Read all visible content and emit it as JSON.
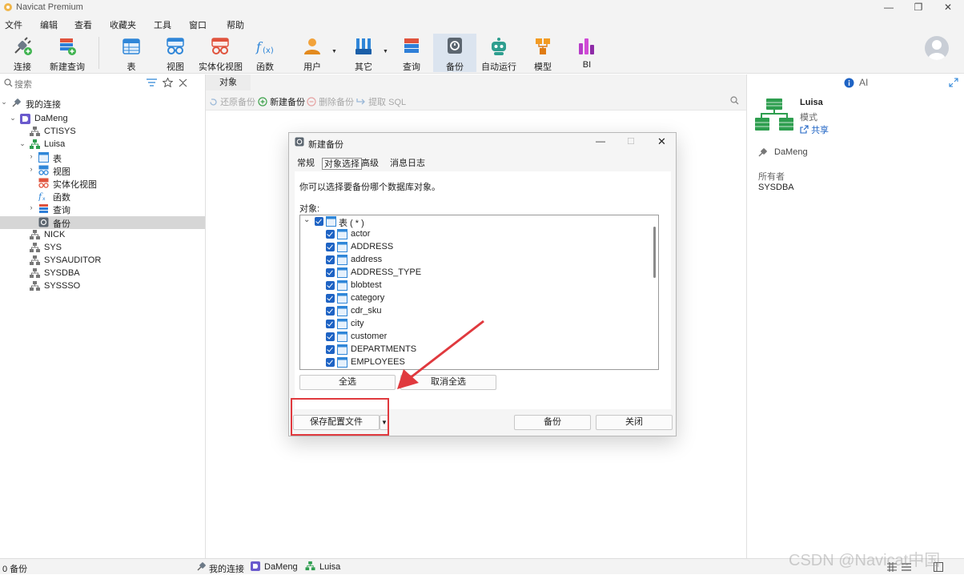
{
  "app": {
    "title": "Navicat Premium"
  },
  "menu": [
    "文件",
    "编辑",
    "查看",
    "收藏夹",
    "工具",
    "窗口",
    "帮助"
  ],
  "toolbar": {
    "connect": "连接",
    "new_query": "新建查询",
    "table": "表",
    "view": "视图",
    "mview": "实体化视图",
    "function": "函数",
    "user": "用户",
    "other": "其它",
    "query": "查询",
    "backup": "备份",
    "auto_run": "自动运行",
    "model": "模型",
    "bi": "BI"
  },
  "sidebar": {
    "search_placeholder": "搜索",
    "root": "我的连接",
    "connection": "DaMeng",
    "schemas": [
      "CTISYS",
      "Luisa",
      "NICK",
      "SYS",
      "SYSAUDITOR",
      "SYSDBA",
      "SYSSSO"
    ],
    "luisa_children": [
      "表",
      "视图",
      "实体化视图",
      "函数",
      "查询",
      "备份"
    ]
  },
  "main": {
    "tab": "对象",
    "actions": {
      "restore": "还原备份",
      "new": "新建备份",
      "delete": "删除备份",
      "extract": "提取 SQL"
    }
  },
  "right_panel": {
    "ai_label": "AI",
    "name": "Luisa",
    "type": "模式",
    "share": "共享",
    "connection": "DaMeng",
    "owner_label": "所有者",
    "owner": "SYSDBA"
  },
  "dialog": {
    "title": "新建备份",
    "tabs": [
      "常规",
      "对象选择",
      "高级",
      "消息日志"
    ],
    "hint": "你可以选择要备份哪个数据库对象。",
    "objects_label": "对象:",
    "group_label": "表 ( * )",
    "items": [
      "actor",
      "ADDRESS",
      "address",
      "ADDRESS_TYPE",
      "blobtest",
      "category",
      "cdr_sku",
      "city",
      "customer",
      "DEPARTMENTS",
      "EMPLOYEES"
    ],
    "select_all": "全选",
    "deselect_all": "取消全选",
    "save_profile": "保存配置文件",
    "backup": "备份",
    "close": "关闭"
  },
  "status": {
    "left": "0 备份",
    "crumb_root": "我的连接",
    "crumb_conn": "DaMeng",
    "crumb_schema": "Luisa"
  },
  "watermark": "CSDN @Navicat中国"
}
